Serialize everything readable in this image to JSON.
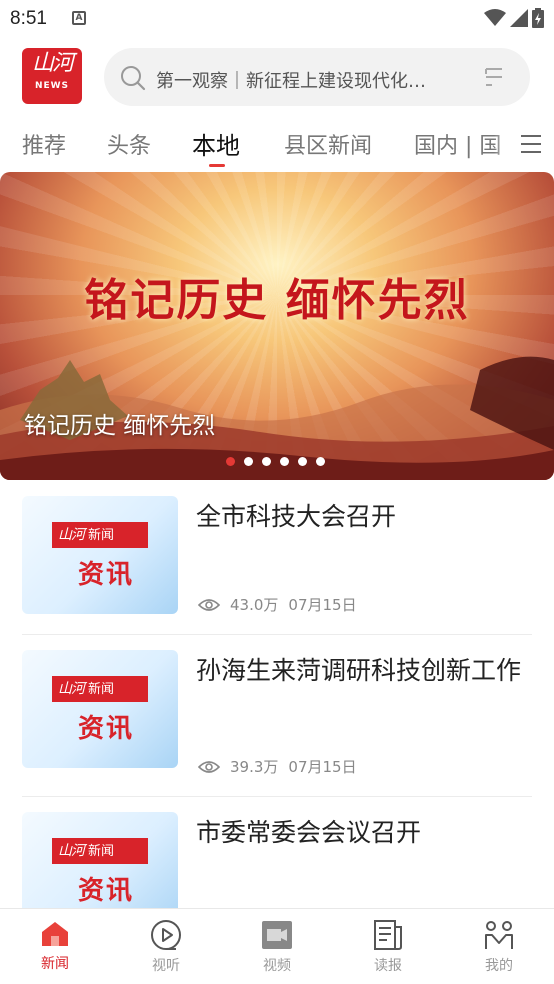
{
  "status_bar": {
    "time": "8:51",
    "notification_icon": "A"
  },
  "header": {
    "logo_mark": "山河",
    "logo_sub": "NEWS",
    "search_placeholder": "第一观察｜新征程上建设现代化…"
  },
  "tabs": [
    {
      "label": "推荐",
      "active": false
    },
    {
      "label": "头条",
      "active": false
    },
    {
      "label": "本地",
      "active": true
    },
    {
      "label": "县区新闻",
      "active": false
    },
    {
      "label": "国内 | 国",
      "active": false
    }
  ],
  "banner": {
    "headline": "铭记历史 缅怀先烈",
    "caption": "铭记历史 缅怀先烈",
    "slide_count": 6,
    "active_slide": 1
  },
  "news": [
    {
      "title": "全市科技大会召开",
      "views": "43.0万",
      "date": "07月15日",
      "thumb_tag": "新闻",
      "thumb_word": "资讯"
    },
    {
      "title": "孙海生来菏调研科技创新工作",
      "views": "39.3万",
      "date": "07月15日",
      "thumb_tag": "新闻",
      "thumb_word": "资讯"
    },
    {
      "title": "市委常委会会议召开",
      "views": "",
      "date": "",
      "thumb_tag": "新闻",
      "thumb_word": "资讯"
    }
  ],
  "bottom_nav": [
    {
      "label": "新闻",
      "icon": "home-icon",
      "active": true
    },
    {
      "label": "视听",
      "icon": "play-circle-icon",
      "active": false
    },
    {
      "label": "视频",
      "icon": "video-icon",
      "active": false
    },
    {
      "label": "读报",
      "icon": "newspaper-icon",
      "active": false
    },
    {
      "label": "我的",
      "icon": "profile-icon",
      "active": false
    }
  ],
  "colors": {
    "brand_red": "#d8232a",
    "accent_red": "#e53935",
    "inactive_gray": "#999999"
  }
}
